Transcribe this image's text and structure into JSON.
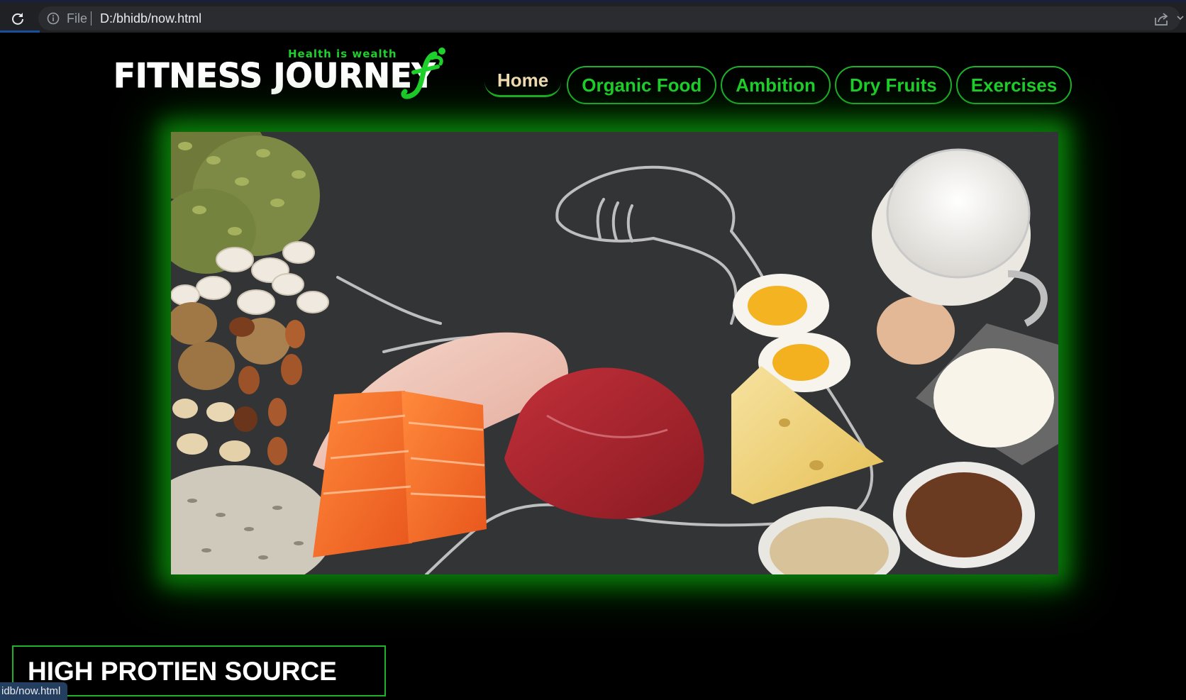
{
  "browser": {
    "file_label": "File",
    "url": "D:/bhidb/now.html",
    "status_url": "idb/now.html"
  },
  "logo": {
    "tagline": "Health is wealth",
    "title": "FITNESS JOURNEY"
  },
  "nav": {
    "items": [
      {
        "label": "Home",
        "active": true
      },
      {
        "label": "Organic Food"
      },
      {
        "label": "Ambition"
      },
      {
        "label": "Dry Fruits"
      },
      {
        "label": "Exercises"
      }
    ]
  },
  "section": {
    "title": "HIGH PROTIEN SOURCE"
  },
  "colors": {
    "accent_green": "#1fd12c",
    "home_text": "#f5deb3",
    "background": "#000000"
  }
}
